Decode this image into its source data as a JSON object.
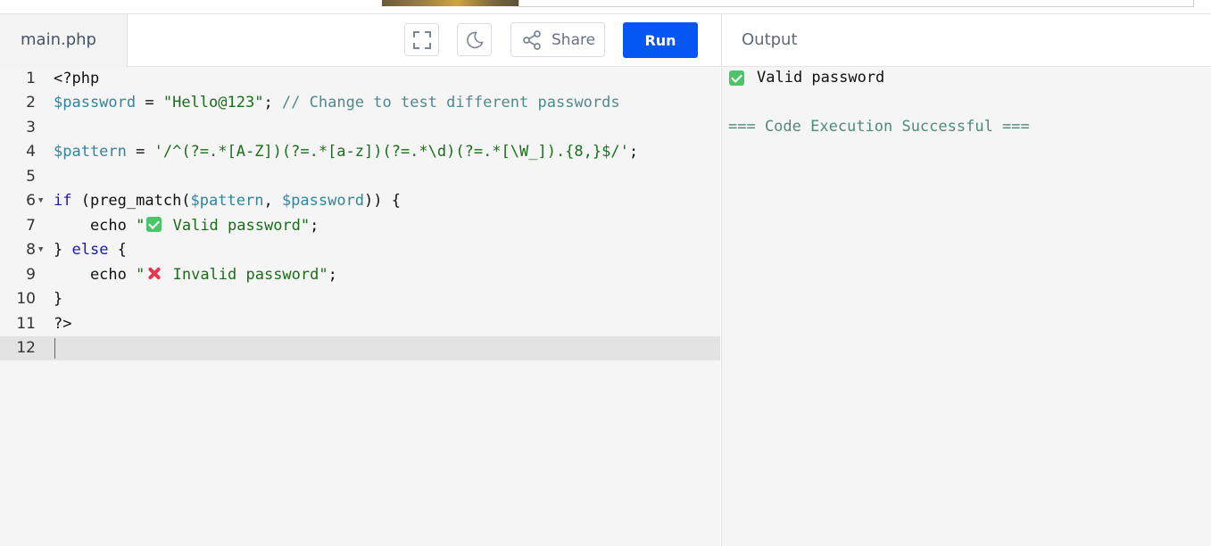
{
  "editor": {
    "file_tab": "main.php",
    "toolbar": {
      "fullscreen_icon": "expand-icon",
      "theme_icon": "moon-icon",
      "share_icon": "share-icon",
      "share_label": "Share",
      "run_label": "Run"
    },
    "line_numbers": [
      "1",
      "2",
      "3",
      "4",
      "5",
      "6",
      "7",
      "8",
      "9",
      "10",
      "11",
      "12"
    ],
    "lines": {
      "l1": "<?php",
      "l2_var": "$password",
      "l2_eq": " = ",
      "l2_str": "\"Hello@123\"",
      "l2_semi": "; ",
      "l2_cmt": "// Change to test different passwords",
      "l4_var": "$pattern",
      "l4_eq": " = ",
      "l4_str": "'/^(?=.*[A-Z])(?=.*[a-z])(?=.*\\d)(?=.*[\\W_]).{8,}$/'",
      "l4_semi": ";",
      "l6_kw": "if",
      "l6_a": " (preg_match(",
      "l6_var1": "$pattern",
      "l6_b": ", ",
      "l6_var2": "$password",
      "l6_c": ")) {",
      "l7_echo": "    echo ",
      "l7_q": "\"",
      "l7_str": " Valid password\"",
      "l7_semi": ";",
      "l8_a": "} ",
      "l8_kw": "else",
      "l8_b": " {",
      "l9_echo": "    echo ",
      "l9_q": "\"",
      "l9_str": " Invalid password\"",
      "l9_semi": ";",
      "l10": "}",
      "l11": "?>"
    }
  },
  "output": {
    "title": "Output",
    "result_text": "Valid password",
    "status_text": "=== Code Execution Successful ==="
  },
  "colors": {
    "run_button": "#0556f3",
    "keyword": "#1a1aa6",
    "variable": "#31859c",
    "string": "#1a6e1a",
    "comment": "#4f8a8b",
    "check_emoji": "#4cc46a",
    "cross_emoji": "#e53950"
  }
}
